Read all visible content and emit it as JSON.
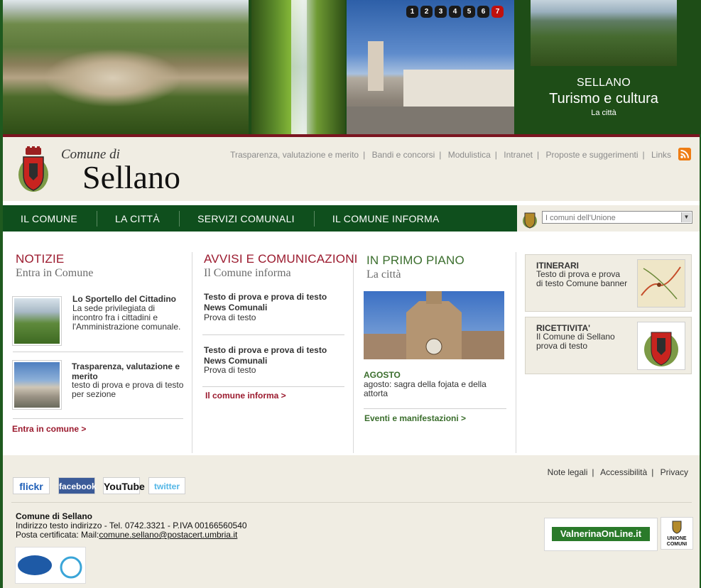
{
  "banner": {
    "slides": [
      "1",
      "2",
      "3",
      "4",
      "5",
      "6",
      "7"
    ],
    "active_slide": "7",
    "caption_line1": "SELLANO",
    "caption_line2": "Turismo e cultura",
    "caption_line3": "La città"
  },
  "header": {
    "logo_small": "Comune di",
    "logo_big": "Sellano",
    "top_links": [
      "Trasparenza, valutazione e merito",
      "Bandi e concorsi",
      "Modulistica",
      "Intranet",
      "Proposte e suggerimenti",
      "Links"
    ]
  },
  "nav": {
    "items": [
      "IL COMUNE",
      "LA CITTÀ",
      "SERVIZI COMUNALI",
      "IL COMUNE INFORMA"
    ],
    "select_value": "I comuni dell'Unione"
  },
  "notizie": {
    "title": "NOTIZIE",
    "subtitle": "Entra in Comune",
    "items": [
      {
        "title": "Lo Sportello del Cittadino",
        "text": "La  sede privilegiata di incontro fra i cittadini e l'Amministrazione comunale."
      },
      {
        "title": "Trasparenza, valutazione e merito",
        "text": "testo di prova e prova di testo per sezione"
      }
    ],
    "more": "Entra in comune >"
  },
  "avvisi": {
    "title": "AVVISI E COMUNICAZIONI",
    "subtitle": "Il Comune informa",
    "items": [
      {
        "title": "Testo di prova e prova di testo",
        "category": "News Comunali",
        "text": "Prova di testo"
      },
      {
        "title": "Testo di prova e prova di testo",
        "category": "News Comunali",
        "text": "Prova di testo"
      }
    ],
    "more": "Il comune informa >"
  },
  "primo_piano": {
    "title": "IN PRIMO PIANO",
    "subtitle": "La città",
    "item_title": "AGOSTO",
    "item_text": "agosto: sagra della fojata e della attorta",
    "more": "Eventi e manifestazioni >"
  },
  "sidebar": {
    "boxes": [
      {
        "title": "ITINERARI",
        "text": "Testo di prova e prova di testo Comune banner"
      },
      {
        "title": "RICETTIVITA'",
        "text": "Il Comune di Sellano prova di testo"
      }
    ]
  },
  "footer": {
    "links": [
      "Note legali",
      "Accessibilità",
      "Privacy"
    ],
    "social": [
      "flickr",
      "facebook",
      "YouTube",
      "twitter"
    ],
    "org_name": "Comune di Sellano",
    "address": "Indirizzo testo indirizzo  - Tel. 0742.3321 - P.IVA 00166560540",
    "pec_label": "Posta certificata: Mail:",
    "pec_email": "comune.sellano@postacert.umbria.it",
    "valnerina": "ValnerinaOnLine.it",
    "unione_line1": "UNIONE",
    "unione_line2": "COMUNI"
  },
  "colors": {
    "dark_green": "#0f4f1d",
    "accent_red": "#9b1a2e",
    "accent_green": "#3b6e2d",
    "cream": "#f0ede3"
  }
}
